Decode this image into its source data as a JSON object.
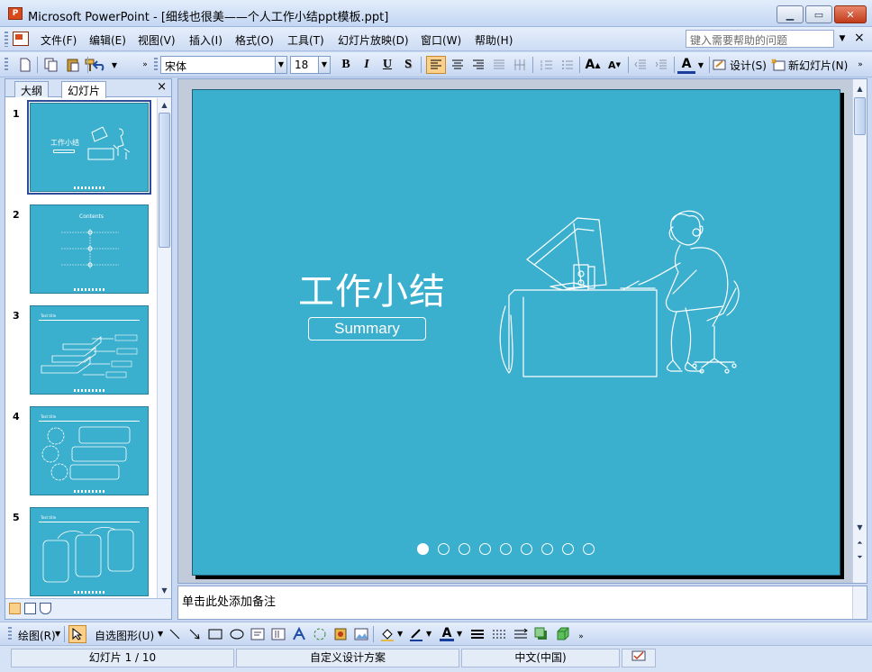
{
  "window": {
    "title": "Microsoft PowerPoint - [细线也很美——个人工作小结ppt模板.ppt]",
    "app_icon_text": "P"
  },
  "menubar": {
    "items": [
      "文件(F)",
      "编辑(E)",
      "视图(V)",
      "插入(I)",
      "格式(O)",
      "工具(T)",
      "幻灯片放映(D)",
      "窗口(W)",
      "帮助(H)"
    ],
    "help_placeholder": "键入需要帮助的问题"
  },
  "format_toolbar": {
    "font_name": "宋体",
    "font_size": "18",
    "bold": "B",
    "italic": "I",
    "underline": "U",
    "shadow": "S",
    "design_label": "设计(S)",
    "new_slide_label": "新幻灯片(N)"
  },
  "left_pane": {
    "tab_outline": "大纲",
    "tab_slides": "幻灯片",
    "close": "×",
    "thumbnails": [
      {
        "number": "1",
        "title": "工作小结",
        "selected": true
      },
      {
        "number": "2",
        "title": "Contents",
        "selected": false
      },
      {
        "number": "3",
        "title": "Text title",
        "selected": false
      },
      {
        "number": "4",
        "title": "Text title",
        "selected": false
      },
      {
        "number": "5",
        "title": "Text title",
        "selected": false
      }
    ]
  },
  "slide": {
    "background": "#3aafce",
    "title": "工作小结",
    "subtitle": "Summary",
    "dots_total": 9,
    "dots_active_index": 0
  },
  "notes": {
    "placeholder": "单击此处添加备注"
  },
  "draw_toolbar": {
    "draw_label": "绘图(R)",
    "autoshapes_label": "自选图形(U)"
  },
  "statusbar": {
    "slide_info": "幻灯片 1 / 10",
    "design": "自定义设计方案",
    "language": "中文(中国)"
  }
}
